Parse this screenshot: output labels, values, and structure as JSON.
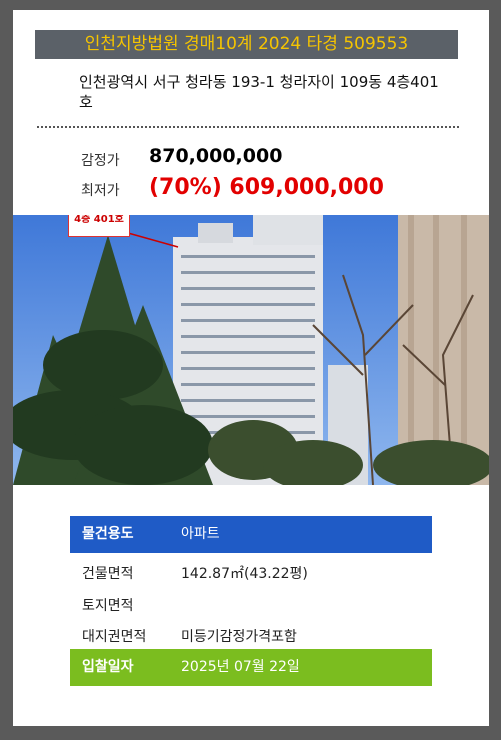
{
  "header": {
    "title": "인천지방법원 경매10계 2024 타경 509553"
  },
  "address": "인천광역시 서구 청라동 193-1 청라자이 109동 4층401호",
  "prices": {
    "appraised_label": "감정가",
    "appraised_value": "870,000,000",
    "minimum_label": "최저가",
    "minimum_value": "(70%) 609,000,000"
  },
  "photo": {
    "overlay_label": "4층 401호"
  },
  "info": {
    "usage_label": "물건용도",
    "usage_value": "아파트",
    "building_area_label": "건물면적",
    "building_area_value": "142.87㎡(43.22평)",
    "land_area_label": "토지면적",
    "land_area_value": "",
    "land_right_label": "대지권면적",
    "land_right_value": "미등기감정가격포함",
    "bid_date_label": "입찰일자",
    "bid_date_value": "2025년 07월 22일"
  },
  "colors": {
    "title_bg": "#5b6168",
    "title_text": "#f5c400",
    "minimum_price": "#e20000",
    "usage_bg": "#1f5bc6",
    "bid_bg": "#7bbd1f"
  }
}
